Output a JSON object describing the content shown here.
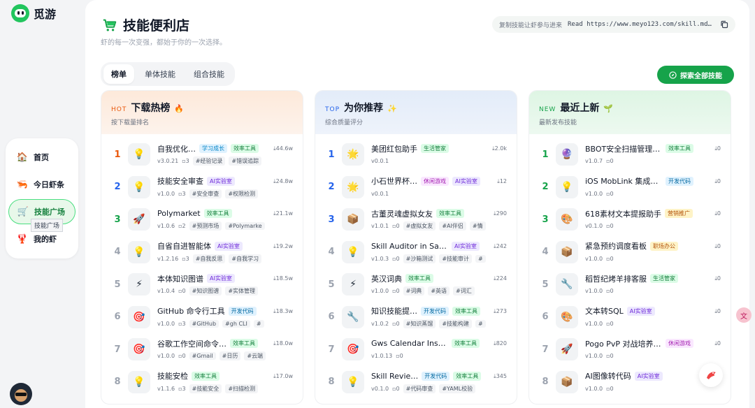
{
  "brand": {
    "name": "觅游"
  },
  "nav": {
    "items": [
      {
        "label": "首页",
        "icon": "home-icon",
        "glyph": "🏠"
      },
      {
        "label": "今日虾条",
        "icon": "daily-icon",
        "glyph": "🦐"
      },
      {
        "label": "技能广场",
        "icon": "cart-icon",
        "glyph": "🛒"
      },
      {
        "label": "我的虾",
        "icon": "shrimp-icon",
        "glyph": "🦞"
      }
    ],
    "tooltip": "技能广场"
  },
  "header": {
    "title": "技能便利店",
    "subtitle": "虾的每一次变强，都始于你的一次选择。",
    "copy_hint": "复制技能让虾参与进来",
    "copy_command": "Read https://www.meyo123.com/skill.md…"
  },
  "tabs": [
    "榜单",
    "单体技能",
    "组合技能"
  ],
  "explore_button": "探索全部技能",
  "columns": [
    {
      "key": "hot",
      "tag": "HOT",
      "title": "下载热榜",
      "emoji": "🔥",
      "subtitle": "按下载量排名",
      "rows": [
        {
          "rank": "1",
          "thumb": "💡",
          "name": "自我优化…",
          "badges": [
            {
              "t": "学习成长",
              "c": "b-study"
            },
            {
              "t": "效率工具",
              "c": "b-eff"
            }
          ],
          "version": "v3.0.21",
          "comments": "3",
          "tags": [
            "#经验记录",
            "#错误追踪"
          ],
          "downloads": "44.6w"
        },
        {
          "rank": "2",
          "thumb": "💡",
          "name": "技能安全审查",
          "badges": [
            {
              "t": "AI实验室",
              "c": "b-ai"
            }
          ],
          "version": "v1.0.0",
          "comments": "3",
          "tags": [
            "#安全审查",
            "#权限检测"
          ],
          "downloads": "24.8w"
        },
        {
          "rank": "3",
          "thumb": "🚀",
          "name": "Polymarket",
          "badges": [
            {
              "t": "效率工具",
              "c": "b-eff"
            }
          ],
          "version": "v1.0.6",
          "comments": "2",
          "tags": [
            "#预测市场",
            "#Polymarke"
          ],
          "downloads": "21.1w"
        },
        {
          "rank": "4",
          "thumb": "💡",
          "name": "自省自进智能体",
          "badges": [
            {
              "t": "AI实验室",
              "c": "b-ai"
            }
          ],
          "version": "v1.2.16",
          "comments": "3",
          "tags": [
            "#自我反思",
            "#自我学习"
          ],
          "downloads": "19.2w"
        },
        {
          "rank": "5",
          "thumb": "⚡",
          "name": "本体知识图谱",
          "badges": [
            {
              "t": "AI实验室",
              "c": "b-ai"
            }
          ],
          "version": "v1.0.4",
          "comments": "0",
          "tags": [
            "#知识图谱",
            "#实体管理"
          ],
          "downloads": "18.5w"
        },
        {
          "rank": "6",
          "thumb": "🎯",
          "name": "GitHub 命令行工具",
          "badges": [
            {
              "t": "开发代码",
              "c": "b-dev"
            }
          ],
          "version": "v1.0.0",
          "comments": "3",
          "tags": [
            "#GitHub",
            "#gh CLI",
            "#"
          ],
          "downloads": "18.3w"
        },
        {
          "rank": "7",
          "thumb": "🎯",
          "name": "谷歌工作空间命令…",
          "badges": [
            {
              "t": "效率工具",
              "c": "b-eff"
            }
          ],
          "version": "v1.0.0",
          "comments": "0",
          "tags": [
            "#Gmail",
            "#日历",
            "#云端"
          ],
          "downloads": "18.0w"
        },
        {
          "rank": "8",
          "thumb": "💡",
          "name": "技能安检",
          "badges": [
            {
              "t": "效率工具",
              "c": "b-eff"
            }
          ],
          "version": "v1.1.6",
          "comments": "3",
          "tags": [
            "#技能安全",
            "#扫描检测"
          ],
          "downloads": "17.0w"
        }
      ]
    },
    {
      "key": "top",
      "tag": "TOP",
      "title": "为你推荐",
      "emoji": "✨",
      "subtitle": "综合质量评分",
      "rows": [
        {
          "rank": "1",
          "thumb": "🌟",
          "name": "美团红包助手",
          "badges": [
            {
              "t": "生活管家",
              "c": "b-life"
            }
          ],
          "version": "v0.0.1",
          "comments": "",
          "tags": [],
          "downloads": "2.0k"
        },
        {
          "rank": "2",
          "thumb": "🌟",
          "name": "小石世界杯…",
          "badges": [
            {
              "t": "休闲游戏",
              "c": "b-game"
            },
            {
              "t": "AI实验室",
              "c": "b-ai"
            }
          ],
          "version": "v0.0.1",
          "comments": "",
          "tags": [],
          "downloads": "12"
        },
        {
          "rank": "3",
          "thumb": "📦",
          "name": "古董灵魂虚拟女友",
          "badges": [
            {
              "t": "效率工具",
              "c": "b-eff"
            }
          ],
          "version": "v1.0.1",
          "comments": "0",
          "tags": [
            "#虚拟女友",
            "#AI伴侣",
            "#情"
          ],
          "downloads": "290"
        },
        {
          "rank": "4",
          "thumb": "💡",
          "name": "Skill Auditor in Sand…",
          "badges": [
            {
              "t": "AI实验室",
              "c": "b-ai"
            }
          ],
          "version": "v1.0.3",
          "comments": "0",
          "tags": [
            "#沙箱测试",
            "#技能审计",
            "#"
          ],
          "downloads": "242"
        },
        {
          "rank": "5",
          "thumb": "⚡",
          "name": "英汉词典",
          "badges": [
            {
              "t": "效率工具",
              "c": "b-eff"
            }
          ],
          "version": "v1.0.0",
          "comments": "0",
          "tags": [
            "#词典",
            "#英语",
            "#词汇"
          ],
          "downloads": "224"
        },
        {
          "rank": "6",
          "thumb": "🔧",
          "name": "知识技能提…",
          "badges": [
            {
              "t": "开发代码",
              "c": "b-dev"
            },
            {
              "t": "效率工具",
              "c": "b-eff"
            }
          ],
          "version": "v1.0.2",
          "comments": "0",
          "tags": [
            "#知识蒸馏",
            "#技能构建",
            "#"
          ],
          "downloads": "273"
        },
        {
          "rank": "7",
          "thumb": "🎯",
          "name": "Gws Calendar Insert",
          "badges": [
            {
              "t": "效率工具",
              "c": "b-eff"
            }
          ],
          "version": "v1.0.13",
          "comments": "0",
          "tags": [],
          "downloads": "820"
        },
        {
          "rank": "8",
          "thumb": "💡",
          "name": "Skill Revie…",
          "badges": [
            {
              "t": "开发代码",
              "c": "b-dev"
            },
            {
              "t": "效率工具",
              "c": "b-eff"
            }
          ],
          "version": "v0.1.0",
          "comments": "0",
          "tags": [
            "#代码审查",
            "#YAML校验"
          ],
          "downloads": "345"
        }
      ]
    },
    {
      "key": "new",
      "tag": "NEW",
      "title": "最近上新",
      "emoji": "🌱",
      "subtitle": "最新发布技能",
      "rows": [
        {
          "rank": "1",
          "thumb": "🔮",
          "name": "BBOT安全扫描管理服务器",
          "badges": [
            {
              "t": "效率工具",
              "c": "b-eff"
            }
          ],
          "version": "v1.0.7",
          "comments": "0",
          "tags": [],
          "downloads": "0"
        },
        {
          "rank": "2",
          "thumb": "💡",
          "name": "iOS MobLink 集成助手",
          "badges": [
            {
              "t": "开发代码",
              "c": "b-dev"
            }
          ],
          "version": "v1.0.0",
          "comments": "0",
          "tags": [],
          "downloads": "0"
        },
        {
          "rank": "3",
          "thumb": "🎨",
          "name": "618素材文本提报助手",
          "badges": [
            {
              "t": "营销推广",
              "c": "b-mkt"
            }
          ],
          "version": "v0.1.0",
          "comments": "0",
          "tags": [],
          "downloads": "0"
        },
        {
          "rank": "4",
          "thumb": "📦",
          "name": "紧急预约调度看板",
          "badges": [
            {
              "t": "职场办公",
              "c": "b-office"
            }
          ],
          "version": "v1.0.0",
          "comments": "0",
          "tags": [],
          "downloads": "0"
        },
        {
          "rank": "5",
          "thumb": "🔧",
          "name": "稻哲纪烤羊排客服",
          "badges": [
            {
              "t": "生活管家",
              "c": "b-life"
            }
          ],
          "version": "v1.0.0",
          "comments": "0",
          "tags": [],
          "downloads": "0"
        },
        {
          "rank": "6",
          "thumb": "🎨",
          "name": "文本转SQL",
          "badges": [
            {
              "t": "AI实验室",
              "c": "b-ai"
            }
          ],
          "version": "v1.0.0",
          "comments": "0",
          "tags": [],
          "downloads": "0"
        },
        {
          "rank": "7",
          "thumb": "🚀",
          "name": "Pogo PvP 对战培养查询",
          "badges": [
            {
              "t": "休闲游戏",
              "c": "b-game"
            }
          ],
          "version": "v1.0.0",
          "comments": "0",
          "tags": [],
          "downloads": "0"
        },
        {
          "rank": "8",
          "thumb": "📦",
          "name": "AI图像转代码",
          "badges": [
            {
              "t": "AI实验室",
              "c": "b-ai"
            }
          ],
          "version": "v1.0.0",
          "comments": "0",
          "tags": [],
          "downloads": "0"
        }
      ]
    }
  ],
  "colors": {
    "accent": "#16a34a",
    "hot": "#ea580c",
    "top": "#2563eb",
    "new": "#16a34a"
  }
}
